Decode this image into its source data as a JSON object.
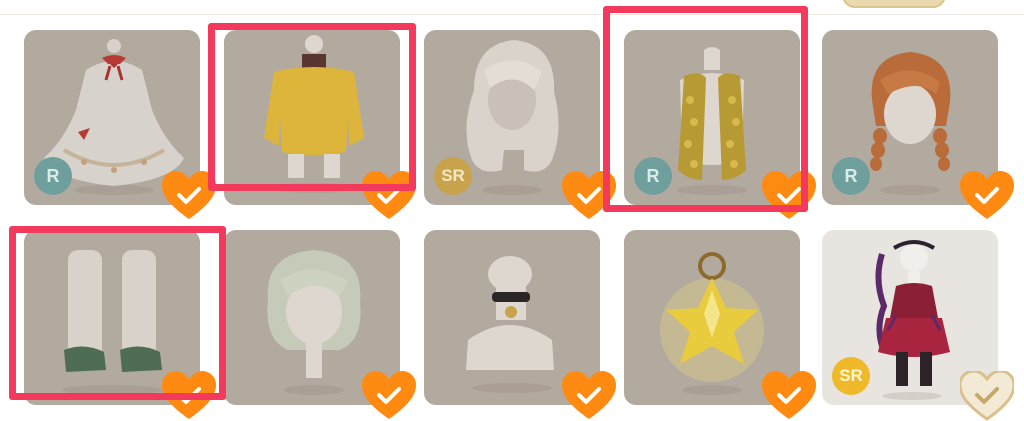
{
  "colors": {
    "card_bg": "#b8ada2",
    "owned_heart": "#ff8a12",
    "unowned_heart": "#efe3c8",
    "highlight_frame": "#f33a5c",
    "rarity_r": "#6f9f9c",
    "rarity_sr": "#c9a24c"
  },
  "items": [
    {
      "art": "dress-icon",
      "rarity": "R",
      "owned": true
    },
    {
      "art": "yellow-sweater-icon",
      "rarity": "",
      "owned": true
    },
    {
      "art": "long-hair-icon",
      "rarity": "SR",
      "owned": true
    },
    {
      "art": "yellow-scarf-icon",
      "rarity": "R",
      "owned": true
    },
    {
      "art": "braided-hair-icon",
      "rarity": "R",
      "owned": true
    },
    {
      "art": "socks-shoes-icon",
      "rarity": "",
      "owned": true
    },
    {
      "art": "short-hair-icon",
      "rarity": "",
      "owned": true
    },
    {
      "art": "choker-icon",
      "rarity": "",
      "owned": true
    },
    {
      "art": "star-ornament-icon",
      "rarity": "",
      "owned": true
    },
    {
      "art": "doll-outfit-icon",
      "rarity": "SR",
      "owned": false
    }
  ]
}
